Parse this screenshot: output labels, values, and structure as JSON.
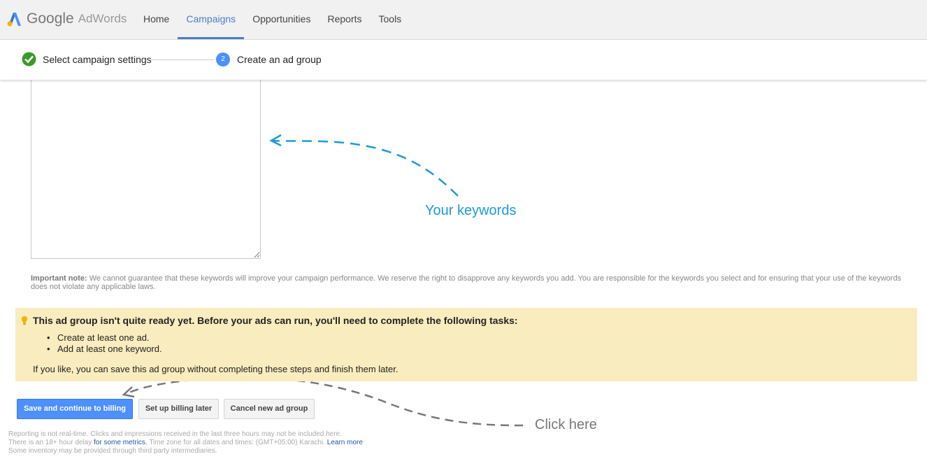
{
  "header": {
    "brand_google": "Google",
    "brand_product": "AdWords",
    "nav": [
      {
        "label": "Home",
        "active": false
      },
      {
        "label": "Campaigns",
        "active": true
      },
      {
        "label": "Opportunities",
        "active": false
      },
      {
        "label": "Reports",
        "active": false
      },
      {
        "label": "Tools",
        "active": false
      }
    ]
  },
  "stepper": {
    "step1_label": "Select campaign settings",
    "step2_number": "2",
    "step2_label": "Create an ad group"
  },
  "keywords": {
    "value": ""
  },
  "important_note": {
    "label": "Important note:",
    "text": " We cannot guarantee that these keywords will improve your campaign performance. We reserve the right to disapprove any keywords you add. You are responsible for the keywords you select and for ensuring that your use of the keywords does not violate any applicable laws."
  },
  "annotations": {
    "keywords": "Your keywords",
    "click": "Click here"
  },
  "warning": {
    "title": "This ad group isn't quite ready yet. Before your ads can run, you'll need to complete the following tasks:",
    "tasks": [
      "Create at least one ad.",
      "Add at least one keyword."
    ],
    "footer": "If you like, you can save this ad group without completing these steps and finish them later."
  },
  "buttons": {
    "save": "Save and continue to billing",
    "billing_later": "Set up billing later",
    "cancel": "Cancel new ad group"
  },
  "footer": {
    "line1": "Reporting is not real-time. Clicks and impressions received in the last three hours may not be included here.",
    "line2_pre": "There is an 18+ hour delay ",
    "line2_link": "for some metrics.",
    "line2_post": " Time zone for all dates and times: (GMT+05:00) Karachi. ",
    "line2_learn": "Learn more",
    "line3": "Some inventory may be provided through third party intermediaries."
  },
  "colors": {
    "accent": "#4d7cc8",
    "primary_button": "#4d90fe",
    "warning_bg": "#f9ecbe",
    "annotation_blue": "#1e9ad6",
    "check_green": "#3a9a2a"
  },
  "icons": [
    "adwords-logo-icon",
    "check-circle-icon",
    "lightbulb-icon",
    "resize-handle-icon"
  ]
}
